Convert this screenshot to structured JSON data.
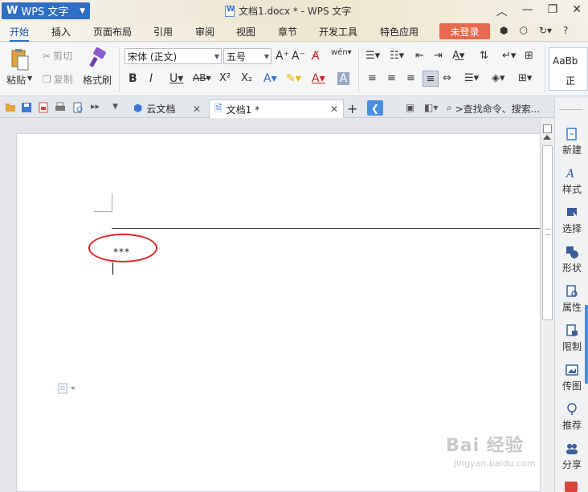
{
  "app": {
    "menu_logo": "W",
    "menu_name": "WPS 文字",
    "window_title": "文档1.docx * - WPS 文字"
  },
  "menu_tabs": [
    "开始",
    "插入",
    "页面布局",
    "引用",
    "审阅",
    "视图",
    "章节",
    "开发工具",
    "特色应用"
  ],
  "login_label": "未登录",
  "help_label": "?",
  "ribbon": {
    "paste": "粘贴",
    "cut": "剪切",
    "copy": "复制",
    "format_painter": "格式刷",
    "font_name": "宋体 (正文)",
    "font_size": "五号",
    "style_preview_1": "AaBb",
    "style_preview_2": "正"
  },
  "doc_tabs": {
    "cloud": "云文档",
    "doc": "文档1 *",
    "search_placeholder": ">查找命令、搜索..."
  },
  "document": {
    "content": "***"
  },
  "side_panel": [
    "新建",
    "样式",
    "选择",
    "形状",
    "属性",
    "限制",
    "传图",
    "推荐",
    "分享"
  ],
  "watermark": {
    "main": "Bai 经验",
    "sub": "jingyan.baidu.com"
  },
  "colors": {
    "accent": "#2e6fc4",
    "login": "#e8694e",
    "annotation": "#e02424"
  }
}
